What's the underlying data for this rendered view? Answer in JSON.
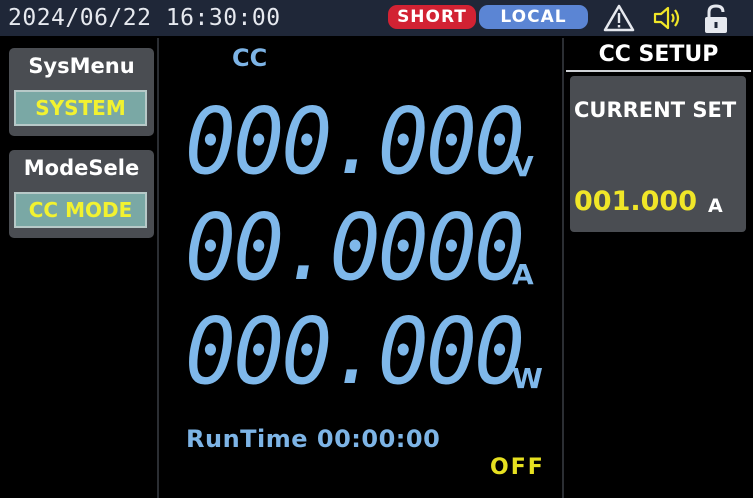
{
  "status_bar": {
    "datetime": "2024/06/22 16:30:00",
    "short_badge": "SHORT",
    "local_badge": "LOCAL",
    "icons": [
      "warning-icon",
      "speaker-icon",
      "unlock-icon"
    ]
  },
  "left_panel": {
    "sysmenu": {
      "title": "SysMenu",
      "button": "SYSTEM"
    },
    "modesele": {
      "title": "ModeSele",
      "button": "CC MODE"
    }
  },
  "display": {
    "mode": "CC",
    "voltage": "000.000",
    "voltage_unit": "V",
    "current": "00.0000",
    "current_unit": "A",
    "power": "000.000",
    "power_unit": "W",
    "runtime": "RunTime 00:00:00",
    "output_state": "OFF"
  },
  "right_panel": {
    "title": "CC SETUP",
    "current_set_label": "CURRENT SET",
    "current_set_value": "001.000",
    "current_set_unit": "A"
  },
  "colors": {
    "topbar": "#1f2738",
    "short": "#d22233",
    "local": "#5b85d4",
    "readout": "#7fb8ea",
    "accent_yellow": "#f0e628",
    "panel": "#4a4d52"
  }
}
